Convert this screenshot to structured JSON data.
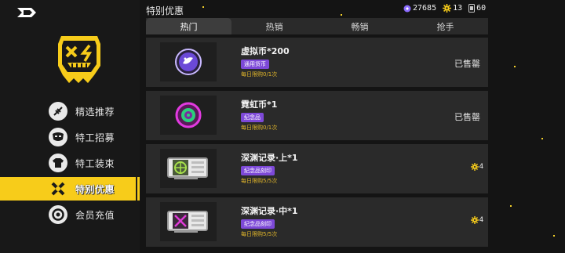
{
  "header": {
    "section_title": "特别优惠",
    "currencies": [
      {
        "icon": "gem-currency-icon",
        "value": "27685",
        "color": "#8c6cff"
      },
      {
        "icon": "gear-currency-icon",
        "value": "13",
        "color": "#f7cc1a"
      },
      {
        "icon": "ticket-currency-icon",
        "value": "60",
        "color": "#c8c8c8"
      }
    ]
  },
  "sidebar": {
    "items": [
      {
        "label": "精选推荐",
        "icon": "feature-star-icon",
        "active": false
      },
      {
        "label": "特工招募",
        "icon": "agent-mask-icon",
        "active": false
      },
      {
        "label": "特工装束",
        "icon": "outfit-shirt-icon",
        "active": false
      },
      {
        "label": "特别优惠",
        "icon": "discount-cross-icon",
        "active": true
      },
      {
        "label": "会员充值",
        "icon": "coin-recharge-icon",
        "active": false
      }
    ]
  },
  "tabs": [
    {
      "label": "热门",
      "active": true
    },
    {
      "label": "热销",
      "active": false
    },
    {
      "label": "畅销",
      "active": false
    },
    {
      "label": "抢手",
      "active": false
    }
  ],
  "items": [
    {
      "name": "虚拟币*200",
      "tag": "通用货币",
      "limit": "每日限购0/1次",
      "status": "已售罄",
      "price": null
    },
    {
      "name": "霓虹币*1",
      "tag": "纪念品",
      "limit": "每日限购0/1次",
      "status": "已售罄",
      "price": null
    },
    {
      "name": "深渊记录·上*1",
      "tag": "纪念品刻印",
      "limit": "每日限购5/5次",
      "status": null,
      "price": "4"
    },
    {
      "name": "深渊记录·中*1",
      "tag": "纪念品刻印",
      "limit": "每日限购5/5次",
      "status": null,
      "price": "4"
    }
  ],
  "colors": {
    "accent": "#f7cc1a",
    "tag_purple": "#7d49d8",
    "limit_gold": "#e0b52a"
  }
}
